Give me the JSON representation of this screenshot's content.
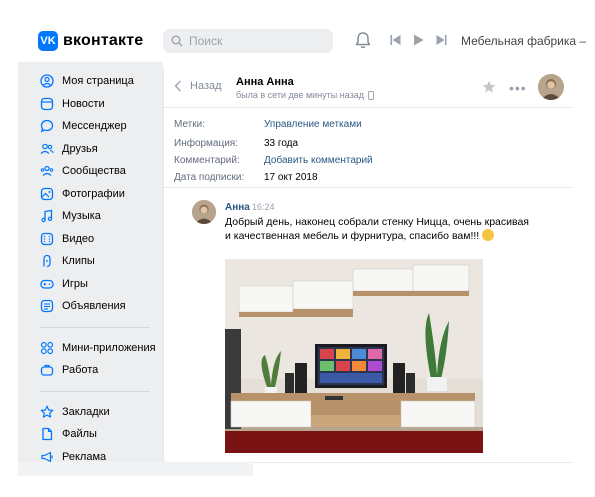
{
  "header": {
    "logo_letter": "VK",
    "logo_text": "вконтакте",
    "search_placeholder": "Поиск",
    "player_track": "Мебельная фабрика –"
  },
  "sidebar": {
    "items": [
      {
        "label": "Моя страница",
        "icon": "user-circle-icon"
      },
      {
        "label": "Новости",
        "icon": "news-icon"
      },
      {
        "label": "Мессенджер",
        "icon": "chat-bubble-icon"
      },
      {
        "label": "Друзья",
        "icon": "friends-icon"
      },
      {
        "label": "Сообщества",
        "icon": "communities-icon"
      },
      {
        "label": "Фотографии",
        "icon": "photo-icon"
      },
      {
        "label": "Музыка",
        "icon": "music-note-icon"
      },
      {
        "label": "Видео",
        "icon": "video-icon"
      },
      {
        "label": "Клипы",
        "icon": "clips-icon"
      },
      {
        "label": "Игры",
        "icon": "gamepad-icon"
      },
      {
        "label": "Объявления",
        "icon": "classifieds-icon"
      }
    ],
    "items2": [
      {
        "label": "Мини-приложения",
        "icon": "apps-icon"
      },
      {
        "label": "Работа",
        "icon": "work-icon"
      }
    ],
    "items3": [
      {
        "label": "Закладки",
        "icon": "star-icon"
      },
      {
        "label": "Файлы",
        "icon": "file-icon"
      },
      {
        "label": "Реклама",
        "icon": "ads-icon"
      }
    ]
  },
  "chat": {
    "back_label": "Назад",
    "peer_name": "Анна Анна",
    "peer_status": "была в сети две минуты назад",
    "info": [
      {
        "key": "Метки:",
        "value": "Управление метками",
        "link": true
      },
      {
        "key": "Информация:",
        "value": "33 года",
        "link": false
      },
      {
        "key": "Комментарий:",
        "value": "Добавить комментарий",
        "link": true
      },
      {
        "key": "Дата подписки:",
        "value": "17 окт 2018",
        "link": false
      }
    ],
    "message": {
      "author": "Анна",
      "time": "16:24",
      "text": "Добрый день, наконец собрали стенку Ницца, очень красивая и качественная мебель и фурнитура, спасибо вам!!!"
    }
  },
  "colors": {
    "accent": "#0077ff",
    "link": "#2a5885",
    "sidebar_bg": "#edeef0",
    "muted": "#818c99"
  }
}
